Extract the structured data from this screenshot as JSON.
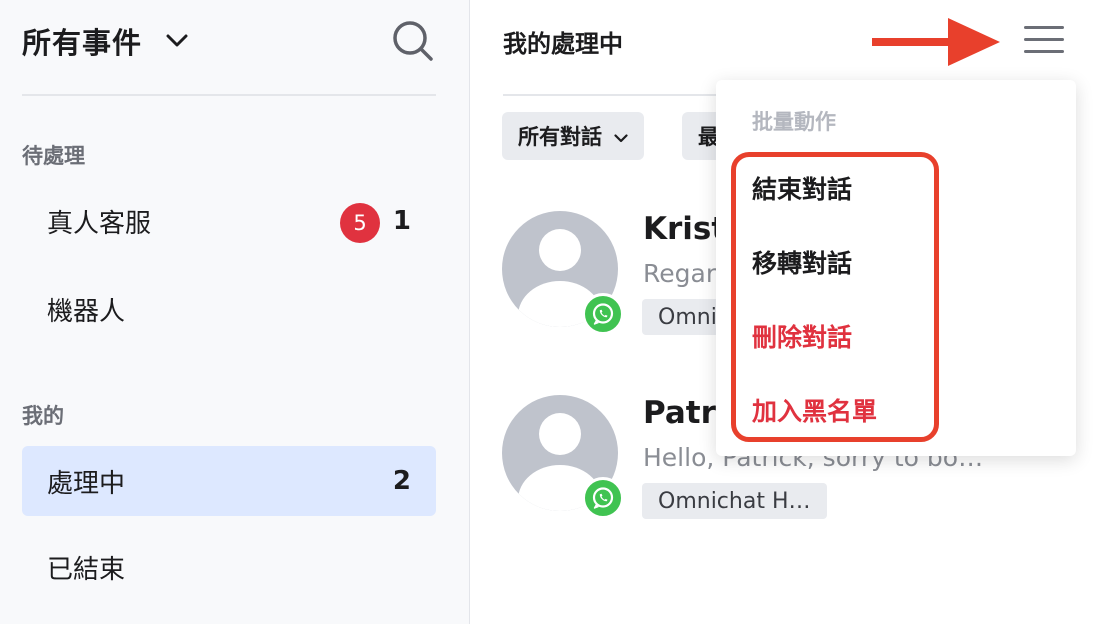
{
  "sidebar": {
    "title": "所有事件",
    "sections": {
      "pending": "待處理",
      "mine": "我的"
    },
    "items": [
      {
        "label": "真人客服",
        "badge": "5",
        "count": "1"
      },
      {
        "label": "機器人"
      },
      {
        "label": "處理中",
        "count": "2",
        "active": true
      },
      {
        "label": "已結束"
      }
    ]
  },
  "main": {
    "title": "我的處理中",
    "filters": [
      {
        "label": "所有對話"
      },
      {
        "label": "最"
      }
    ],
    "conversations": [
      {
        "name": "Krist",
        "preview": "Regar",
        "tag": "Omni",
        "channel": "whatsapp-icon"
      },
      {
        "name": "Patri",
        "preview": "Hello, Patrick, sorry to bo…",
        "tag": "Omnichat H…",
        "channel": "whatsapp-icon"
      }
    ]
  },
  "menu": {
    "header": "批量動作",
    "items": [
      {
        "label": "結束對話",
        "danger": false
      },
      {
        "label": "移轉對話",
        "danger": false
      },
      {
        "label": "刪除對話",
        "danger": true
      },
      {
        "label": "加入黑名單",
        "danger": true
      }
    ]
  },
  "colors": {
    "accent_active": "#dde8ff",
    "badge": "#e0323f",
    "danger": "#e0323f",
    "whatsapp": "#40c351",
    "annotation": "#e8402c"
  }
}
